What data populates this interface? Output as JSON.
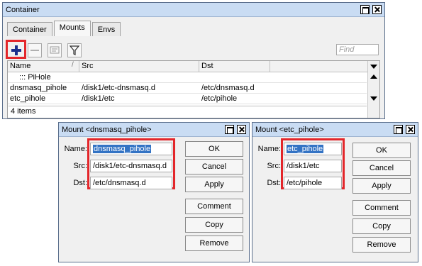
{
  "main_window": {
    "title": "Container",
    "tabs": [
      "Container",
      "Mounts",
      "Envs"
    ],
    "active_tab": "Mounts",
    "find_placeholder": "Find",
    "table": {
      "headers": [
        "Name",
        "Src",
        "Dst"
      ],
      "group_row": "::: PiHole",
      "rows": [
        {
          "name": "dnsmasq_pihole",
          "src": "/disk1/etc-dnsmasq.d",
          "dst": "/etc/dnsmasq.d"
        },
        {
          "name": "etc_pihole",
          "src": "/disk1/etc",
          "dst": "/etc/pihole"
        }
      ]
    },
    "status": "4 items"
  },
  "dialog1": {
    "title": "Mount <dnsmasq_pihole>",
    "labels": {
      "name": "Name:",
      "src": "Src:",
      "dst": "Dst:"
    },
    "values": {
      "name": "dnsmasq_pihole",
      "src": "/disk1/etc-dnsmasq.d",
      "dst": "/etc/dnsmasq.d"
    },
    "buttons": [
      "OK",
      "Cancel",
      "Apply",
      "Comment",
      "Copy",
      "Remove"
    ]
  },
  "dialog2": {
    "title": "Mount <etc_pihole>",
    "labels": {
      "name": "Name:",
      "src": "Src:",
      "dst": "Dst:"
    },
    "values": {
      "name": "etc_pihole",
      "src": "/disk1/etc",
      "dst": "/etc/pihole"
    },
    "buttons": [
      "OK",
      "Cancel",
      "Apply",
      "Comment",
      "Copy",
      "Remove"
    ]
  },
  "colors": {
    "highlight": "#e3262a",
    "titlebar": "#c9dcf3",
    "selection": "#3373c4",
    "add_icon": "#1a2f8c"
  },
  "icons": [
    "add-icon",
    "remove-icon",
    "comment-icon",
    "filter-icon",
    "sort-arrow-icon",
    "maximize-icon",
    "close-icon"
  ]
}
